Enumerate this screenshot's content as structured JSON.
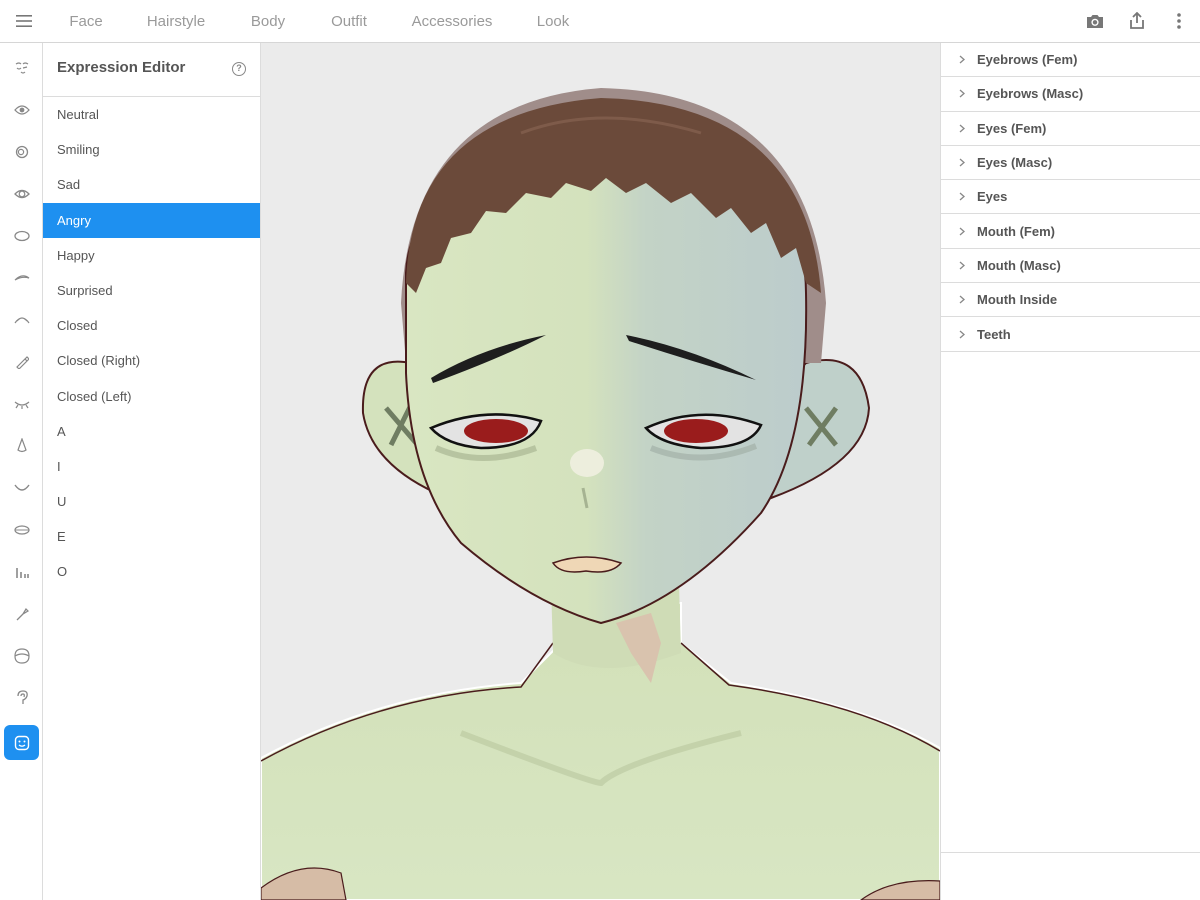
{
  "top_tabs": [
    {
      "label": "Face",
      "active": true
    },
    {
      "label": "Hairstyle",
      "active": false
    },
    {
      "label": "Body",
      "active": false
    },
    {
      "label": "Outfit",
      "active": false
    },
    {
      "label": "Accessories",
      "active": false
    },
    {
      "label": "Look",
      "active": false
    }
  ],
  "top_actions": [
    "camera-icon",
    "share-icon",
    "more-vertical-icon"
  ],
  "rail_icons": [
    "face-shape-icon",
    "eye-icon",
    "iris-icon",
    "eye-outline-icon",
    "oval-icon",
    "eyebrow-icon",
    "eyelash-icon",
    "eyeliner-pen-icon",
    "closed-eye-lash-icon",
    "nose-icon",
    "mouth-curve-icon",
    "lips-icon",
    "teeth-bars-icon",
    "brush-icon",
    "head-outline-icon",
    "ear-icon",
    "expression-face-icon"
  ],
  "rail_active_index": 16,
  "expression_editor": {
    "title": "Expression Editor",
    "help_symbol": "?",
    "items": [
      "Neutral",
      "Smiling",
      "Sad",
      "Angry",
      "Happy",
      "Surprised",
      "Closed",
      "Closed (Right)",
      "Closed (Left)",
      "A",
      "I",
      "U",
      "E",
      "O"
    ],
    "selected": "Angry"
  },
  "right_panel": {
    "categories": [
      "Eyebrows (Fem)",
      "Eyebrows (Masc)",
      "Eyes (Fem)",
      "Eyes (Masc)",
      "Eyes",
      "Mouth (Fem)",
      "Mouth (Masc)",
      "Mouth Inside",
      "Teeth"
    ]
  },
  "colors": {
    "accent": "#1e90f0",
    "viewport_bg": "#ebebeb",
    "skin": "#d4e3bf",
    "hair": "#6b4a3a",
    "eye_iris": "#9a1c1c"
  }
}
